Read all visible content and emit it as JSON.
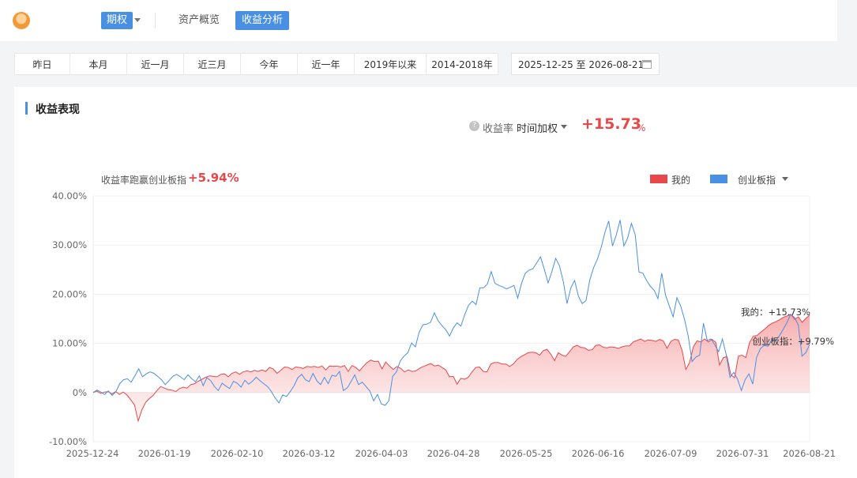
{
  "header": {
    "account": "期权",
    "tabs": [
      {
        "label": "资产概览",
        "active": false
      },
      {
        "label": "收益分析",
        "active": true
      }
    ]
  },
  "ranges": [
    "昨日",
    "本月",
    "近一月",
    "近三月",
    "今年",
    "近一年",
    "2019年以来",
    "2014-2018年"
  ],
  "date_range": "2025-12-25 至 2026-08-21",
  "section": {
    "title": "收益表现"
  },
  "summary": {
    "rate_label": "收益率",
    "mode": "时间加权",
    "value": "+15.73",
    "unit": "%",
    "beat_label": "收益率跑赢创业板指",
    "beat_value": "+5.94%"
  },
  "legend": [
    {
      "name": "我的",
      "color": "#e8484a"
    },
    {
      "name": "创业板指",
      "color": "#4a90e2"
    }
  ],
  "colors": {
    "mine": "#e8484a",
    "index": "#4a90e2",
    "accent": "#4a90e2"
  },
  "icons": {
    "help": "question-icon",
    "calendar": "calendar-icon",
    "caret": "chevron-down-icon"
  },
  "chart_data": {
    "type": "area",
    "ylim": [
      -10,
      40
    ],
    "y_ticks": [
      "40.00%",
      "30.00%",
      "20.00%",
      "10.00%",
      "0%",
      "-10.00%"
    ],
    "y_tick_values": [
      40,
      30,
      20,
      10,
      0,
      -10
    ],
    "x_tick_labels": [
      "2025-12-24",
      "2026-01-19",
      "2026-02-10",
      "2026-03-12",
      "2026-04-03",
      "2026-04-28",
      "2026-05-25",
      "2026-06-16",
      "2026-07-09",
      "2026-07-31",
      "2026-08-21"
    ],
    "series": [
      {
        "name": "我的",
        "end_label": "我的：+15.73%",
        "values": [
          0,
          0.3,
          -0.2,
          0.1,
          0.2,
          -0.3,
          0.2,
          -0.4,
          0.1,
          -0.5,
          -1.5,
          -2.5,
          -5.8,
          -3.5,
          -2,
          -1.2,
          -0.6,
          0.4,
          1.2,
          0.9,
          0.6,
          0.5,
          0.2,
          0.8,
          1.1,
          0.9,
          1.6,
          1.8,
          2.3,
          2.7,
          3.1,
          3.4,
          3.3,
          3.2,
          3.7,
          3.8,
          3.2,
          3.9,
          4.2,
          3.7,
          4.2,
          4.4,
          4.2,
          4.5,
          4.3,
          4.6,
          4.3,
          5.1,
          4.8,
          3.9,
          4.5,
          5.2,
          5.1,
          4.7,
          5.2,
          5.1,
          4.9,
          5.3,
          5.2,
          5.3,
          5.1,
          5.4,
          4.6,
          5.4,
          5.3,
          5.4,
          5.2,
          5.5,
          4.3,
          5.5,
          5.1,
          4.4,
          5.3,
          6.1,
          6.6,
          6.3,
          6.4,
          4.8,
          6.2,
          5.4,
          4.7,
          5.3,
          4.9,
          4.2,
          4.6,
          4.3,
          4.4,
          4.9,
          5.3,
          5.6,
          5.9,
          5.4,
          5.6,
          5.1,
          4.6,
          3.2,
          3.3,
          1.7,
          2.9,
          2.7,
          3.1,
          4.2,
          5.1,
          5.2,
          4.3,
          4.2,
          5.8,
          6.1,
          6.1,
          5.8,
          5.8,
          5.3,
          5.8,
          6.7,
          7.3,
          7.7,
          8.1,
          8.2,
          8.1,
          7.6,
          8.5,
          8.8,
          7.8,
          6.5,
          8.1,
          7.6,
          7.4,
          8.3,
          9.3,
          9.6,
          9.2,
          9.1,
          8.6,
          8.7,
          9.6,
          9.7,
          9.2,
          9.1,
          9.3,
          9.2,
          9.0,
          9.3,
          9.5,
          9.5,
          10.3,
          10.6,
          10.9,
          10.4,
          10.7,
          10.6,
          10.4,
          10.8,
          10.5,
          9.0,
          10.4,
          10.8,
          10.7,
          8.6,
          4.7,
          6.1,
          9.3,
          10.5,
          10.3,
          10.9,
          10.3,
          10.8,
          10.2,
          5.6,
          7.1,
          7.3,
          3.6,
          3.0,
          7.4,
          7.6,
          7.1,
          10.2,
          11.5,
          11.6,
          12.3,
          12.9,
          13.6,
          14.1,
          14.4,
          14.8,
          15.3,
          15.6,
          15.9,
          14.9,
          15.4,
          14.3,
          15.1,
          15.73
        ]
      },
      {
        "name": "创业板指",
        "end_label": "创业板指：+9.79%",
        "values": [
          0,
          0.5,
          0.1,
          -0.4,
          0.3,
          -0.6,
          0.2,
          1.8,
          2.6,
          2.8,
          2.1,
          3.4,
          4.8,
          3.2,
          3.8,
          4.2,
          3.9,
          3.3,
          2.6,
          1.6,
          2.4,
          3.3,
          3.7,
          3.2,
          2.6,
          3.6,
          2.8,
          2.2,
          3.4,
          1.4,
          3,
          2.4,
          1.2,
          0.4,
          1.9,
          1.3,
          0.8,
          2.3,
          1.9,
          1.1,
          2.5,
          1.7,
          2.3,
          3.1,
          2.4,
          1.8,
          1.2,
          0.2,
          -1.1,
          -2.1,
          -0.5,
          -0.8,
          0.2,
          1.4,
          3,
          3.7,
          2.6,
          2.2,
          3.9,
          2.4,
          1.6,
          3.1,
          1.8,
          3.5,
          3.3,
          4.3,
          0.4,
          0.9,
          2.2,
          3.6,
          1.6,
          2.1,
          1.2,
          0.3,
          -1.7,
          -0.4,
          -2.3,
          -2.6,
          -1.7,
          3.3,
          4.2,
          6.4,
          7.4,
          8.1,
          10.1,
          9.3,
          12.3,
          13.8,
          13.9,
          14.3,
          16.2,
          14.6,
          13.6,
          12.8,
          11.5,
          13.1,
          14.2,
          13.5,
          15.8,
          17.7,
          18.6,
          17.9,
          21.3,
          21.3,
          22.1,
          24.6,
          22.2,
          21.8,
          21.5,
          21.1,
          21.4,
          21.8,
          19.2,
          22.2,
          24.3,
          24.9,
          25.2,
          26.4,
          27.6,
          25.1,
          22.3,
          24.6,
          27.3,
          25.8,
          22.6,
          18.1,
          21.3,
          22.8,
          19.6,
          18.1,
          18.7,
          22.9,
          25.4,
          27.1,
          29.5,
          32.6,
          34.9,
          29.8,
          32.1,
          35.1,
          29.8,
          31.5,
          34.4,
          32.1,
          24.5,
          24.3,
          22.8,
          21.6,
          20.8,
          19.1,
          24.3,
          19.8,
          17.6,
          15.4,
          19.3,
          17.6,
          14.9,
          11.4,
          6.3,
          7.2,
          7.6,
          14.1,
          10.6,
          10.9,
          9.7,
          8.3,
          10.9,
          7.7,
          3.1,
          4.1,
          2.7,
          0.4,
          2.6,
          3.8,
          1.7,
          7.1,
          8.9,
          9.6,
          9.4,
          10.7,
          10.6,
          11.5,
          12.8,
          14.2,
          15.9,
          15.3,
          13.8,
          7.4,
          8.1,
          9.79
        ]
      }
    ]
  }
}
